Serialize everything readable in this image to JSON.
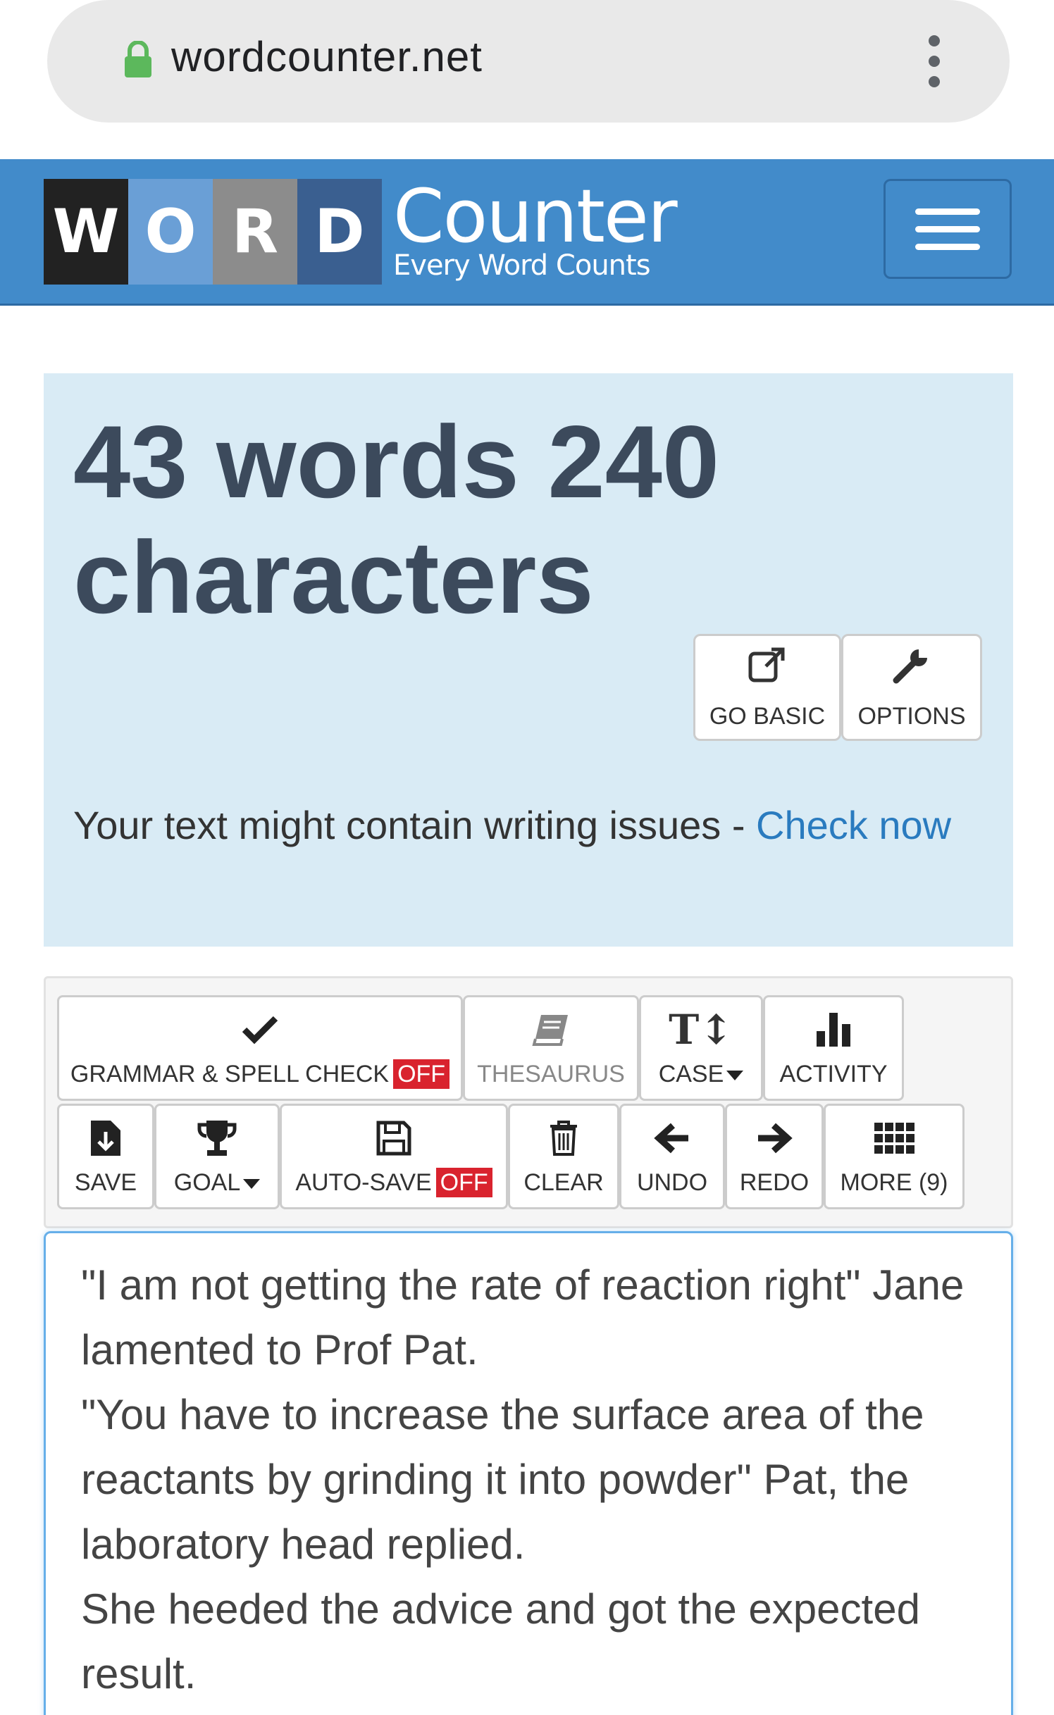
{
  "browser": {
    "url": "wordcounter.net",
    "lock_icon": "lock-icon",
    "menu_icon": "kebab-menu-icon"
  },
  "header": {
    "logo_letters": [
      "W",
      "O",
      "R",
      "D"
    ],
    "logo_main": "Counter",
    "logo_sub": "Every Word Counts",
    "menu_icon": "hamburger-icon",
    "brand_color": "#428bca"
  },
  "counter": {
    "heading": "43 words 240 characters",
    "go_basic_label": "GO BASIC",
    "options_label": "OPTIONS",
    "issues_text": "Your text might contain writing issues - ",
    "issues_link": "Check now",
    "panel_color": "#d9ebf5"
  },
  "toolbar": {
    "grammar_label": "GRAMMAR & SPELL CHECK",
    "grammar_state": "OFF",
    "thesaurus_label": "THESAURUS",
    "case_label": "CASE",
    "activity_label": "ACTIVITY",
    "save_label": "SAVE",
    "goal_label": "GOAL",
    "autosave_label": "AUTO-SAVE",
    "autosave_state": "OFF",
    "clear_label": "CLEAR",
    "undo_label": "UNDO",
    "redo_label": "REDO",
    "more_label": "MORE (9)",
    "off_color": "#d9232e"
  },
  "editor": {
    "text": "\"I am not getting the rate of reaction right\" Jane lamented to Prof Pat.\n\"You have to increase the surface area of the reactants by grinding it into powder\" Pat, the laboratory head replied.\nShe heeded the advice and got the expected result.\n"
  }
}
